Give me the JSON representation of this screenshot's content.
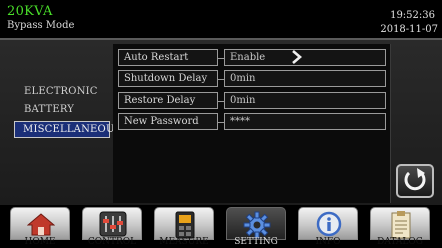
{
  "header": {
    "model": "20KVA",
    "mode": "Bypass Mode",
    "time": "19:52:36",
    "date": "2018-11-07"
  },
  "sidebar": {
    "items": [
      {
        "label": "ELECTRONIC"
      },
      {
        "label": "BATTERY"
      },
      {
        "label": "MISCELLANEOUS"
      }
    ]
  },
  "settings": {
    "rows": [
      {
        "label": "Auto Restart",
        "value": "Enable"
      },
      {
        "label": "Shutdown Delay",
        "value": "0min"
      },
      {
        "label": "Restore Delay",
        "value": "0min"
      },
      {
        "label": "New Password",
        "value": "****"
      }
    ]
  },
  "nav": {
    "tabs": [
      {
        "label": "HOME",
        "icon": "home-icon"
      },
      {
        "label": "CONTROL",
        "icon": "control-icon"
      },
      {
        "label": "MEASURE",
        "icon": "measure-icon"
      },
      {
        "label": "SETTING",
        "icon": "gear-icon"
      },
      {
        "label": "INFO",
        "icon": "info-icon"
      },
      {
        "label": "DATALOG",
        "icon": "datalog-icon"
      }
    ]
  },
  "colors": {
    "model_text": "#4ade2a",
    "active_menu": "#1b2f78",
    "background": "#000000"
  }
}
